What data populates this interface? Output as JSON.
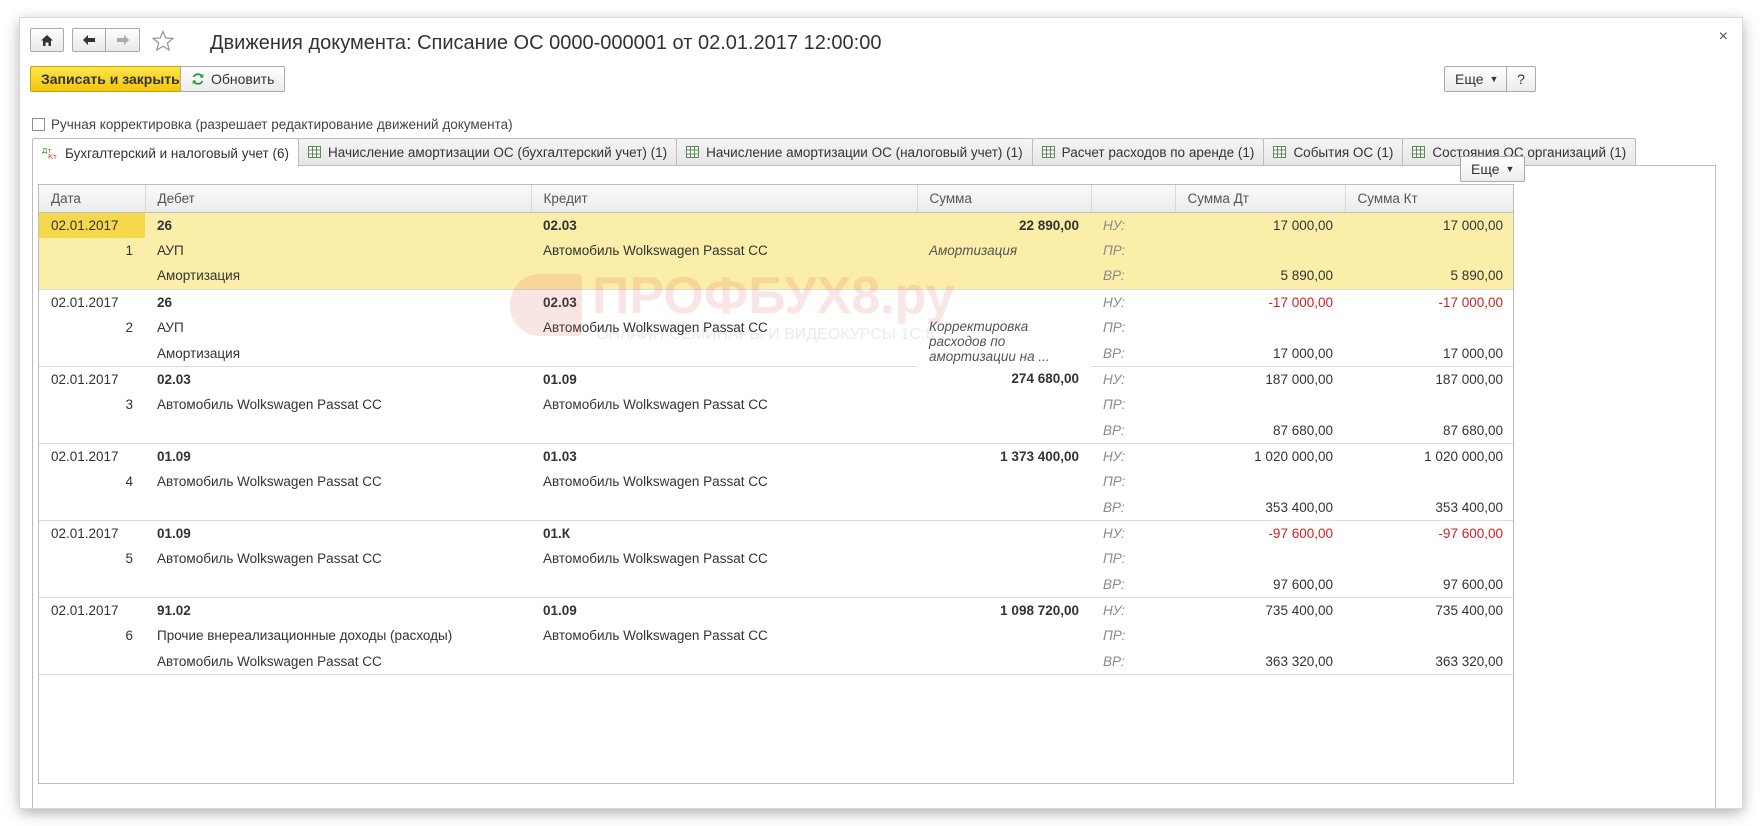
{
  "header": {
    "title": "Движения документа: Списание ОС 0000-000001 от 02.01.2017 12:00:00",
    "close": "×"
  },
  "toolbar": {
    "save_close": "Записать и закрыть",
    "refresh": "Обновить",
    "more": "Еще",
    "help": "?"
  },
  "manual_correction": "Ручная корректировка (разрешает редактирование движений документа)",
  "tabs": [
    {
      "label": "Бухгалтерский и налоговый учет (6)"
    },
    {
      "label": "Начисление амортизации ОС (бухгалтерский учет) (1)"
    },
    {
      "label": "Начисление амортизации ОС (налоговый учет) (1)"
    },
    {
      "label": "Расчет расходов по аренде (1)"
    },
    {
      "label": "События ОС (1)"
    },
    {
      "label": "Состояния ОС организаций (1)"
    }
  ],
  "grid": {
    "more": "Еще",
    "columns": [
      "Дата",
      "Дебет",
      "Кредит",
      "Сумма",
      "",
      "Сумма Дт",
      "Сумма Кт"
    ],
    "labels": [
      "НУ:",
      "ПР:",
      "ВР:"
    ],
    "rows": [
      {
        "date": "02.01.2017",
        "num": "1",
        "dt": [
          "26",
          "АУП",
          "Амортизация"
        ],
        "kt": [
          "02.03",
          "Автомобиль Wolkswagen Passat CC",
          ""
        ],
        "sum": "22 890,00",
        "content": "Амортизация",
        "sdt": [
          "17 000,00",
          "",
          "5 890,00"
        ],
        "skt": [
          "17 000,00",
          "",
          "5 890,00"
        ]
      },
      {
        "date": "02.01.2017",
        "num": "2",
        "dt": [
          "26",
          "АУП",
          "Амортизация"
        ],
        "kt": [
          "02.03",
          "Автомобиль Wolkswagen Passat CC",
          ""
        ],
        "sum": "",
        "content": "Корректировка расходов по амортизации на ...",
        "sdt": [
          "-17 000,00",
          "",
          "17 000,00"
        ],
        "skt": [
          "-17 000,00",
          "",
          "17 000,00"
        ]
      },
      {
        "date": "02.01.2017",
        "num": "3",
        "dt": [
          "02.03",
          "Автомобиль Wolkswagen Passat CC",
          ""
        ],
        "kt": [
          "01.09",
          "Автомобиль Wolkswagen Passat CC",
          ""
        ],
        "sum": "274 680,00",
        "content": "",
        "sdt": [
          "187 000,00",
          "",
          "87 680,00"
        ],
        "skt": [
          "187 000,00",
          "",
          "87 680,00"
        ]
      },
      {
        "date": "02.01.2017",
        "num": "4",
        "dt": [
          "01.09",
          "Автомобиль Wolkswagen Passat CC",
          ""
        ],
        "kt": [
          "01.03",
          "Автомобиль Wolkswagen Passat CC",
          ""
        ],
        "sum": "1 373 400,00",
        "content": "",
        "sdt": [
          "1 020 000,00",
          "",
          "353 400,00"
        ],
        "skt": [
          "1 020 000,00",
          "",
          "353 400,00"
        ]
      },
      {
        "date": "02.01.2017",
        "num": "5",
        "dt": [
          "01.09",
          "Автомобиль Wolkswagen Passat CC",
          ""
        ],
        "kt": [
          "01.К",
          "Автомобиль Wolkswagen Passat CC",
          ""
        ],
        "sum": "",
        "content": "",
        "sdt": [
          "-97 600,00",
          "",
          "97 600,00"
        ],
        "skt": [
          "-97 600,00",
          "",
          "97 600,00"
        ]
      },
      {
        "date": "02.01.2017",
        "num": "6",
        "dt": [
          "91.02",
          "Прочие внереализационные доходы (расходы)",
          "Автомобиль Wolkswagen Passat CC"
        ],
        "kt": [
          "01.09",
          "Автомобиль Wolkswagen Passat CC",
          ""
        ],
        "sum": "1 098 720,00",
        "content": "",
        "sdt": [
          "735 400,00",
          "",
          "363 320,00"
        ],
        "skt": [
          "735 400,00",
          "",
          "363 320,00"
        ]
      }
    ]
  },
  "watermark": {
    "title": "ПРОФБУХ8.ру",
    "subtitle": "ОНЛАЙН-СЕМИНАРЫ И ВИДЕОКУРСЫ 1С:8"
  },
  "colors": {
    "accent_yellow": "#f5c60e",
    "highlight_row": "#fbeea8",
    "negative": "#cc2222"
  }
}
